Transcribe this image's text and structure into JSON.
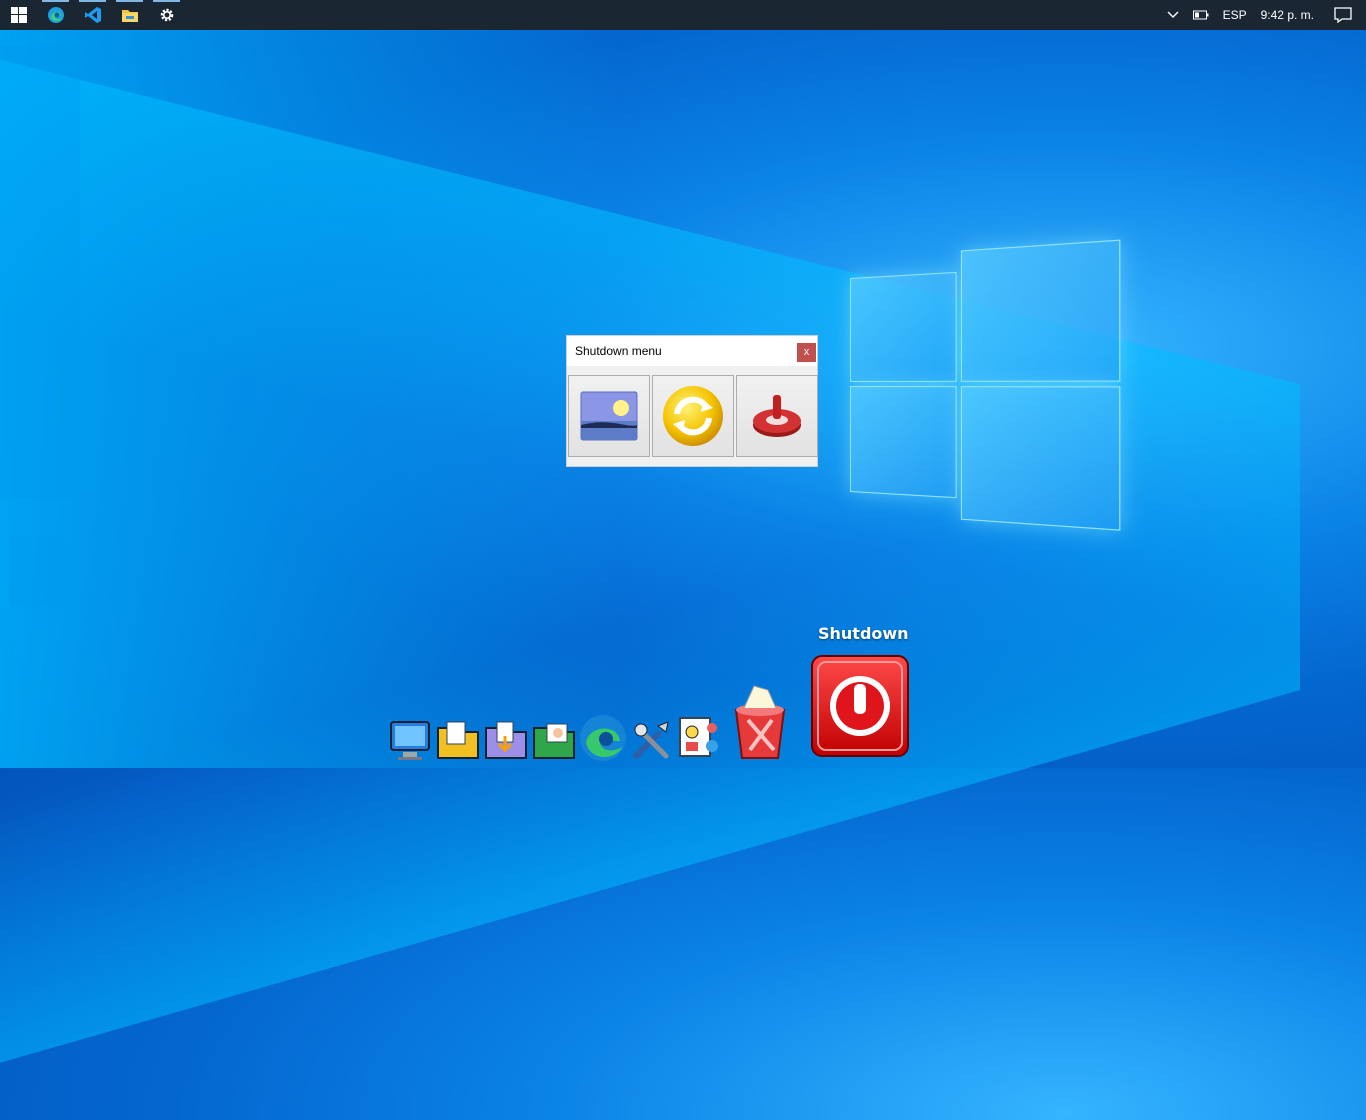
{
  "taskbar": {
    "start_icon": "windows-start-icon",
    "apps": [
      {
        "name": "edge",
        "icon": "edge-icon"
      },
      {
        "name": "vscode",
        "icon": "vscode-icon"
      },
      {
        "name": "file-explorer",
        "icon": "folder-icon"
      },
      {
        "name": "settings",
        "icon": "gear-icon"
      }
    ],
    "tray": {
      "language": "ESP",
      "time": "9:42 p. m."
    }
  },
  "dialog": {
    "title": "Shutdown menu",
    "close_label": "x",
    "buttons": [
      {
        "name": "lock-screen",
        "icon": "landscape-picture-icon"
      },
      {
        "name": "restart",
        "icon": "refresh-arrows-icon"
      },
      {
        "name": "power-off",
        "icon": "power-switch-icon"
      }
    ]
  },
  "dock": {
    "hover_label": "Shutdown",
    "items": [
      {
        "name": "computer",
        "icon": "monitor-icon"
      },
      {
        "name": "documents",
        "icon": "folder-documents-icon"
      },
      {
        "name": "downloads",
        "icon": "folder-downloads-icon"
      },
      {
        "name": "pictures",
        "icon": "folder-pictures-icon"
      },
      {
        "name": "edge",
        "icon": "edge-icon"
      },
      {
        "name": "tools",
        "icon": "tools-icon"
      },
      {
        "name": "control-panel",
        "icon": "control-panel-icon"
      },
      {
        "name": "recycle-bin",
        "icon": "recycle-bin-full-icon"
      },
      {
        "name": "shutdown",
        "icon": "power-button-icon"
      }
    ]
  },
  "colors": {
    "desktop_blue": "#0a82e6",
    "taskbar": "#1b2633",
    "close_button": "#c0504d",
    "shutdown_red": "#e0151b"
  }
}
